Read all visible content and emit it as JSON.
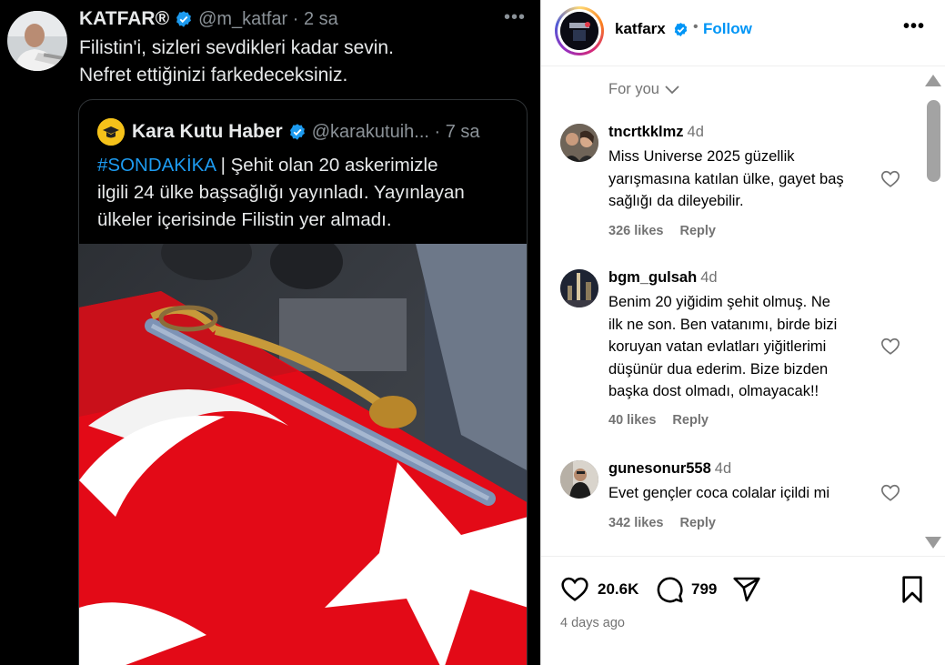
{
  "tweet": {
    "name": "KATFAR®",
    "handle": "@m_katfar · 2 sa",
    "text_line1": "Filistin'i, sizleri sevdikleri kadar sevin.",
    "text_line2": "Nefret ettiğinizi farkedeceksiniz.",
    "quote": {
      "name": "Kara Kutu Haber",
      "handle": "@karakutuih... · 7 sa",
      "hashtag": "#SONDAKİKA",
      "text_line1_rest": " | Şehit olan 20 askerimizle",
      "text_line2": "ilgili 24 ülke başsağlığı yayınladı. Yayınlayan",
      "text_line3": "ülkeler içerisinde Filistin yer almadı."
    }
  },
  "instagram": {
    "username": "katfarx",
    "follow_label": "Follow",
    "sort_label": "For you",
    "comments": [
      {
        "user": "tncrtkklmz",
        "time": "4d",
        "lines": [
          "Miss Universe 2025 güzellik",
          "yarışmasına katılan ülke, gayet baş",
          "sağlığı da dileyebilir."
        ],
        "likes": "326 likes",
        "reply": "Reply"
      },
      {
        "user": "bgm_gulsah",
        "time": "4d",
        "lines": [
          "Benim 20 yiğidim şehit olmuş. Ne",
          "ilk ne son. Ben vatanımı, birde bizi",
          "koruyan vatan evlatları yiğitlerimi",
          "düşünür dua ederim. Bize bizden",
          "başka dost olmadı, olmayacak!!"
        ],
        "likes": "40 likes",
        "reply": "Reply"
      },
      {
        "user": "gunesonur558",
        "time": "4d",
        "lines": [
          "Evet gençler coca colalar içildi mi"
        ],
        "likes": "342 likes",
        "reply": "Reply"
      }
    ],
    "like_count": "20.6K",
    "comment_count": "799",
    "date": "4 days ago"
  },
  "colors": {
    "twitter_bg": "#000000",
    "twitter_blue": "#1d9bf0",
    "ig_blue": "#0095f6",
    "flag_red": "#e30a17"
  },
  "icons": [
    "verified-badge",
    "more-icon",
    "heart-icon",
    "comment-icon",
    "share-icon",
    "bookmark-icon",
    "chevron-down-icon"
  ]
}
